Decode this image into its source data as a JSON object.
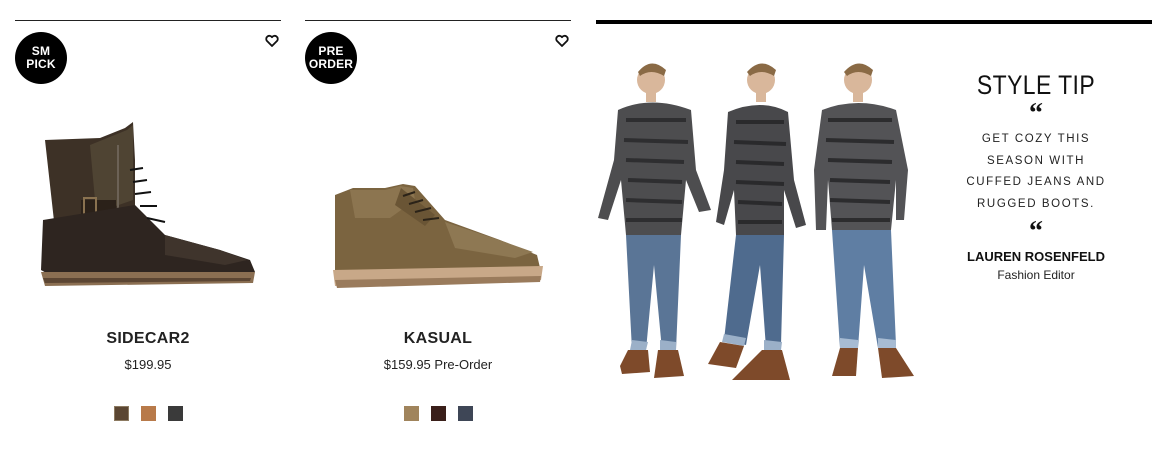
{
  "products": [
    {
      "badge": [
        "SM",
        "PICK"
      ],
      "name": "SIDECAR2",
      "price": "$199.95",
      "swatches": [
        "#5b4632",
        "#b87a4a",
        "#3a3a3a"
      ]
    },
    {
      "badge": [
        "PRE",
        "ORDER"
      ],
      "name": "KASUAL",
      "price": "$159.95 Pre-Order",
      "swatches": [
        "#a0845c",
        "#3a1f1a",
        "#3e4656"
      ]
    }
  ],
  "style_tip": {
    "title": "STYLE TIP",
    "quote_mark": "“",
    "body_lines": [
      "GET COZY THIS",
      "SEASON WITH",
      "CUFFED JEANS AND",
      "RUGGED BOOTS."
    ],
    "author": "LAUREN ROSENFELD",
    "role": "Fashion Editor"
  },
  "icons": {
    "wishlist": "heart-icon"
  }
}
